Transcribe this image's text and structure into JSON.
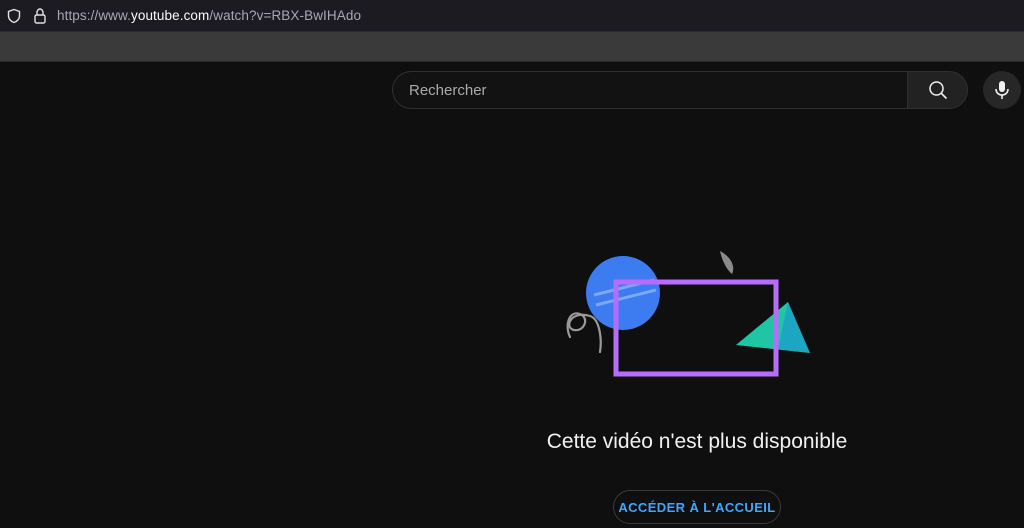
{
  "browser": {
    "url_prefix": "https://www.",
    "url_main": "youtube.com",
    "url_suffix": "/watch?v=RBX-BwIHAdo"
  },
  "search": {
    "placeholder": "Rechercher"
  },
  "error": {
    "message": "Cette vidéo n'est plus disponible",
    "home_button_label": "ACCÉDER À L'ACCUEIL"
  },
  "icons": {
    "shield": "shield-icon",
    "lock": "lock-icon",
    "search": "search-icon",
    "mic": "microphone-icon"
  },
  "colors": {
    "background": "#0f0f0f",
    "accent_link": "#3ea6ff",
    "illustration_circle": "#3d7bf0",
    "illustration_frame": "#b66cff",
    "illustration_triangle": "#1ec6a4"
  }
}
